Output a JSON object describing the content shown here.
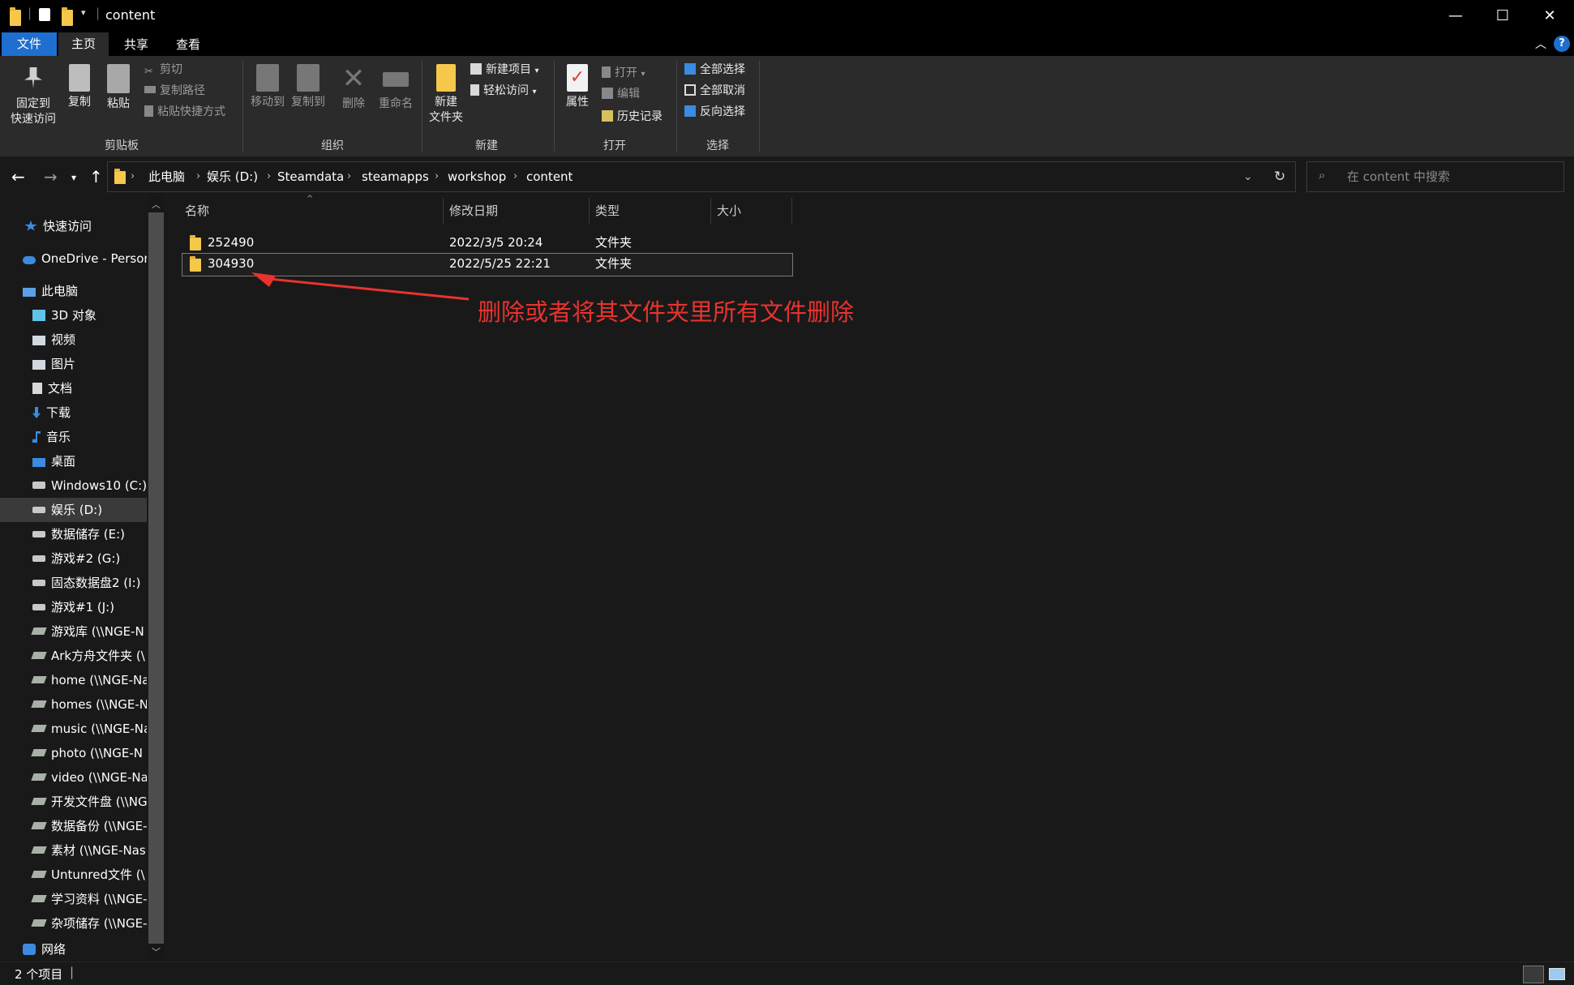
{
  "window": {
    "title": "content"
  },
  "title_controls": {
    "minimize": "—",
    "maximize": "☐",
    "close": "✕"
  },
  "ribbon_tabs": [
    "文件",
    "主页",
    "共享",
    "查看"
  ],
  "ribbon": {
    "clipboard": {
      "pin_line1": "固定到",
      "pin_line2": "快速访问",
      "copy": "复制",
      "paste": "粘贴",
      "cut": "剪切",
      "copy_path": "复制路径",
      "paste_shortcut": "粘贴快捷方式",
      "group": "剪贴板"
    },
    "organize": {
      "move_to": "移动到",
      "copy_to": "复制到",
      "delete": "删除",
      "rename": "重命名",
      "group": "组织"
    },
    "new": {
      "new_folder_line1": "新建",
      "new_folder_line2": "文件夹",
      "new_item": "新建项目",
      "easy_access": "轻松访问",
      "group": "新建"
    },
    "open": {
      "properties": "属性",
      "open": "打开",
      "edit": "编辑",
      "history": "历史记录",
      "group": "打开"
    },
    "select": {
      "select_all": "全部选择",
      "select_none": "全部取消",
      "invert": "反向选择",
      "group": "选择"
    }
  },
  "breadcrumb": [
    "此电脑",
    "娱乐 (D:)",
    "Steamdata",
    "steamapps",
    "workshop",
    "content"
  ],
  "search": {
    "placeholder": "在 content 中搜索"
  },
  "sidebar": [
    {
      "label": "快速访问",
      "icon": "star-icon"
    },
    {
      "label": "OneDrive - Personal",
      "icon": "cloud-icon"
    },
    {
      "label": "此电脑",
      "icon": "computer-icon"
    },
    {
      "label": "3D 对象",
      "icon": "cube-icon"
    },
    {
      "label": "视频",
      "icon": "video-icon"
    },
    {
      "label": "图片",
      "icon": "picture-icon"
    },
    {
      "label": "文档",
      "icon": "document-icon"
    },
    {
      "label": "下载",
      "icon": "download-icon"
    },
    {
      "label": "音乐",
      "icon": "music-icon"
    },
    {
      "label": "桌面",
      "icon": "desktop-icon"
    },
    {
      "label": "Windows10 (C:)",
      "icon": "system-drive-icon"
    },
    {
      "label": "娱乐 (D:)",
      "icon": "drive-icon"
    },
    {
      "label": "数据储存 (E:)",
      "icon": "drive-icon"
    },
    {
      "label": "游戏#2 (G:)",
      "icon": "drive-icon"
    },
    {
      "label": "固态数据盘2 (I:)",
      "icon": "drive-icon"
    },
    {
      "label": "游戏#1 (J:)",
      "icon": "drive-icon"
    },
    {
      "label": "游戏库 (\\\\NGE-N",
      "icon": "network-drive-icon"
    },
    {
      "label": "Ark方舟文件夹 (\\",
      "icon": "network-drive-icon"
    },
    {
      "label": "home (\\\\NGE-Na",
      "icon": "network-drive-icon"
    },
    {
      "label": "homes (\\\\NGE-N",
      "icon": "network-drive-icon"
    },
    {
      "label": "music (\\\\NGE-Na",
      "icon": "network-drive-icon"
    },
    {
      "label": "photo (\\\\NGE-N",
      "icon": "network-drive-icon"
    },
    {
      "label": "video (\\\\NGE-Na",
      "icon": "network-drive-icon"
    },
    {
      "label": "开发文件盘 (\\\\NG",
      "icon": "network-drive-icon"
    },
    {
      "label": "数据备份 (\\\\NGE-",
      "icon": "network-drive-icon"
    },
    {
      "label": "素材 (\\\\NGE-Nas",
      "icon": "network-drive-icon"
    },
    {
      "label": "Untunred文件 (\\",
      "icon": "network-drive-icon"
    },
    {
      "label": "学习资料 (\\\\NGE-",
      "icon": "network-drive-icon"
    },
    {
      "label": "杂项储存 (\\\\NGE-",
      "icon": "network-drive-icon"
    },
    {
      "label": "网络",
      "icon": "network-icon"
    }
  ],
  "columns": [
    "名称",
    "修改日期",
    "类型",
    "大小"
  ],
  "files": [
    {
      "name": "252490",
      "modified": "2022/3/5 20:24",
      "type": "文件夹",
      "size": ""
    },
    {
      "name": "304930",
      "modified": "2022/5/25 22:21",
      "type": "文件夹",
      "size": ""
    }
  ],
  "annotation": {
    "text": "删除或者将其文件夹里所有文件删除",
    "color": "#e8332f"
  },
  "status": {
    "item_count": "2 个项目"
  },
  "colors": {
    "accent": "#1e6fd0",
    "background": "#191919",
    "ribbon": "#2b2b2b",
    "folder": "#f5c84a"
  }
}
